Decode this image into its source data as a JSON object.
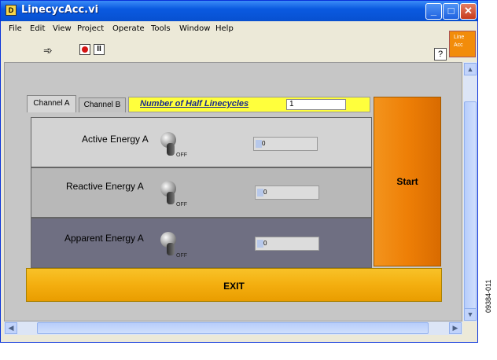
{
  "window": {
    "title": "LinecycAcc.vi",
    "icon_glyph": "D",
    "minimize_glyph": "_",
    "maximize_glyph": "□",
    "close_glyph": "✕"
  },
  "menu": [
    "File",
    "Edit",
    "View",
    "Project",
    "Operate",
    "Tools",
    "Window",
    "Help"
  ],
  "toolbar": {
    "run_icon": "run-arrow-icon",
    "run_glyph": "➾",
    "stop_icon": "abort-icon",
    "pause_icon": "pause-icon",
    "pause_glyph": "II",
    "help_glyph": "?",
    "vi_icon_text": "Line\nAcc"
  },
  "tabs": {
    "channel_a": "Channel A",
    "channel_b": "Channel B",
    "active": "Channel A"
  },
  "half_linecycles": {
    "label": "Number of Half Linecycles",
    "value": "1"
  },
  "rows": [
    {
      "label": "Active Energy A",
      "switch_state": "OFF",
      "value": "0"
    },
    {
      "label": "Reactive Energy A",
      "switch_state": "OFF",
      "value": "0"
    },
    {
      "label": "Apparent Energy A",
      "switch_state": "OFF",
      "value": "0"
    }
  ],
  "buttons": {
    "start": "Start",
    "exit": "EXIT"
  },
  "scroll_glyphs": {
    "up": "▲",
    "down": "▼",
    "left": "◀",
    "right": "▶"
  },
  "figure_code": "09384-011",
  "colors": {
    "title_bar": "#0a5ae0",
    "start_button": "#ee7f06",
    "exit_button": "#f4ae0f",
    "half_bar": "#ffff3c",
    "row_active": "#d3d3d3",
    "row_reactive": "#b8b8b8",
    "row_apparent": "#6f6f82"
  }
}
